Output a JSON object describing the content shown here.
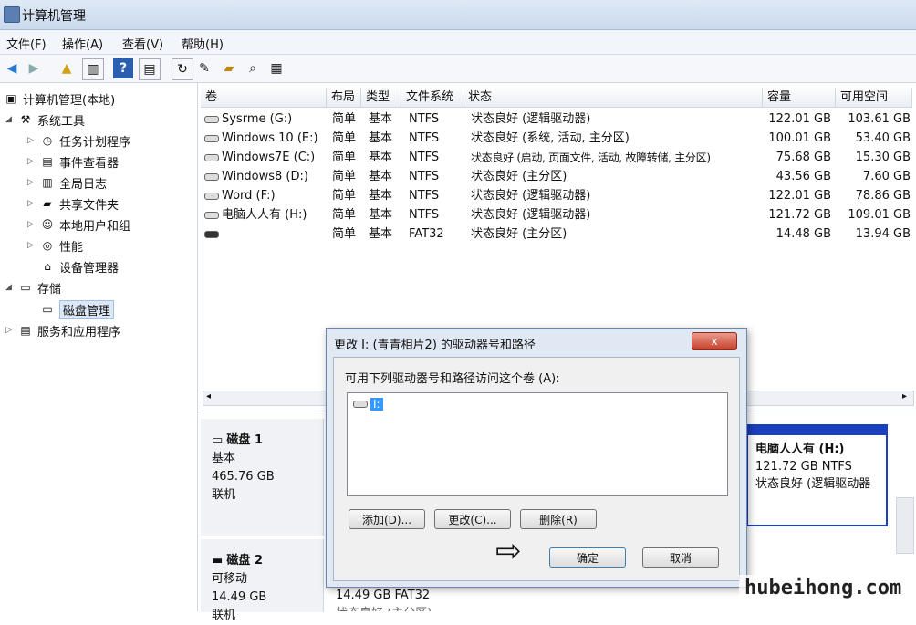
{
  "window": {
    "title": "计算机管理"
  },
  "menu": [
    "文件(F)",
    "操作(A)",
    "查看(V)",
    "帮助(H)"
  ],
  "toolbar_icons": [
    "back-arrow-icon",
    "forward-arrow-icon",
    "up-folder-icon",
    "show-hide-tree-icon",
    "help-icon",
    "properties-icon",
    "refresh-icon",
    "export-icon",
    "open-folder-icon",
    "search-icon",
    "disk-icon"
  ],
  "tree": {
    "root": "计算机管理(本地)",
    "system_tools": "系统工具",
    "task_scheduler": "任务计划程序",
    "event_viewer": "事件查看器",
    "shared_folders": "共享文件夹",
    "local_users": "本地用户和组",
    "performance": "性能",
    "device_manager": "设备管理器",
    "storage": "存储",
    "disk_management": "磁盘管理",
    "services": "服务和应用程序"
  },
  "volumes": {
    "columns": [
      "卷",
      "布局",
      "类型",
      "文件系统",
      "状态",
      "容量",
      "可用空间"
    ],
    "rows": [
      [
        "Sysrme (G:)",
        "简单",
        "基本",
        "NTFS",
        "状态良好 (逻辑驱动器)",
        "122.01 GB",
        "103.61 GB"
      ],
      [
        "Windows 10 (E:)",
        "简单",
        "基本",
        "NTFS",
        "状态良好 (系统, 活动, 主分区)",
        "100.01 GB",
        "53.40 GB"
      ],
      [
        "Windows7E (C:)",
        "简单",
        "基本",
        "NTFS",
        "状态良好 (启动, 页面文件, 活动, 故障转储, 主分区)",
        "75.68 GB",
        "15.30 GB"
      ],
      [
        "Windows8 (D:)",
        "简单",
        "基本",
        "NTFS",
        "状态良好 (主分区)",
        "43.56 GB",
        "7.60 GB"
      ],
      [
        "Word (F:)",
        "简单",
        "基本",
        "NTFS",
        "状态良好 (逻辑驱动器)",
        "122.01 GB",
        "78.86 GB"
      ],
      [
        "电脑人人有 (H:)",
        "简单",
        "基本",
        "NTFS",
        "状态良好 (逻辑驱动器)",
        "121.72 GB",
        "109.01 GB"
      ],
      [
        "",
        "简单",
        "基本",
        "FAT32",
        "状态良好 (主分区)",
        "14.48 GB",
        "13.94 GB"
      ]
    ]
  },
  "disks": {
    "disk1": {
      "name": "磁盘 1",
      "type": "基本",
      "size": "465.76 GB",
      "status": "联机"
    },
    "disk2": {
      "name": "磁盘 2",
      "type": "可移动",
      "size": "14.49 GB",
      "status": "联机"
    },
    "partition": {
      "name": "电脑人人有 (H:)",
      "size": "121.72 GB NTFS",
      "status": "状态良好 (逻辑驱动器"
    },
    "bottom_partition": {
      "size": "14.49 GB FAT32",
      "status": "状态良好 (主分区)"
    }
  },
  "dialog": {
    "title": "更改 I: (青青相片2) 的驱动器号和路径",
    "close": "x",
    "prompt": "可用下列驱动器号和路径访问这个卷 (A):",
    "path_entry": "I:",
    "add": "添加(D)...",
    "change": "更改(C)...",
    "remove": "删除(R)",
    "ok": "确定",
    "cancel": "取消"
  },
  "watermark": "hubeihong.com"
}
